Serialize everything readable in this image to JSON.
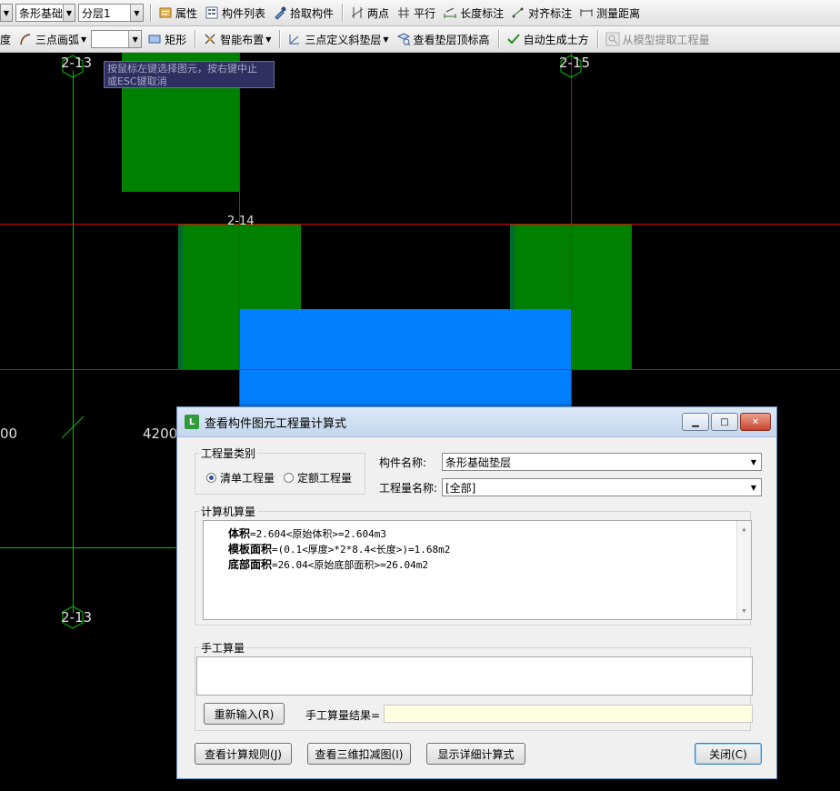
{
  "toolbar1": {
    "component_type": "条形基础",
    "floor": "分层1",
    "properties": "属性",
    "component_list": "构件列表",
    "pick_component": "拾取构件",
    "two_points": "两点",
    "parallel": "平行",
    "length_dim": "长度标注",
    "align_dim": "对齐标注",
    "measure_distance": "测量距离"
  },
  "toolbar2": {
    "partial_left": "度",
    "three_point_arc": "三点画弧",
    "arc_value": "",
    "rectangle": "矩形",
    "smart_layout": "智能布置",
    "three_point_slope": "三点定义斜垫层",
    "view_cushion_top": "查看垫层顶标高",
    "auto_earthwork": "自动生成土方",
    "extract_from_model": "从模型提取工程量"
  },
  "canvas": {
    "axis_labels": [
      "2-13",
      "2-15",
      "2-14",
      "2-13"
    ],
    "dim_left": "00",
    "dim_4200": "4200",
    "tooltip_line1": "按鼠标左键选择图元，按右键中止",
    "tooltip_line2": "或ESC键取消",
    "colors": {
      "green": "#008000",
      "blue": "#0080ff",
      "red": "#e00000",
      "grid_green": "#00c000"
    }
  },
  "dialog": {
    "title": "查看构件图元工程量计算式",
    "quantity_type_label": "工程量类别",
    "radio_list": "清单工程量",
    "radio_quota": "定额工程量",
    "component_name_label": "构件名称:",
    "component_name_value": "条形基础垫层",
    "quantity_name_label": "工程量名称:",
    "quantity_name_value": "[全部]",
    "computer_calc_label": "计算机算量",
    "calc_lines": [
      {
        "name": "体积",
        "formula": "=2.604<原始体积>=2.604m3"
      },
      {
        "name": "模板面积",
        "formula": "=(0.1<厚度>*2*8.4<长度>)=1.68m2"
      },
      {
        "name": "底部面积",
        "formula": "=26.04<原始底部面积>=26.04m2"
      }
    ],
    "manual_calc_label": "手工算量",
    "reenter_button": "重新输入(R)",
    "manual_result_label": "手工算量结果=",
    "view_rules_button": "查看计算规则(J)",
    "view_3d_button": "查看三维扣减图(I)",
    "show_detail_button": "显示详细计算式",
    "close_button": "关闭(C)"
  }
}
